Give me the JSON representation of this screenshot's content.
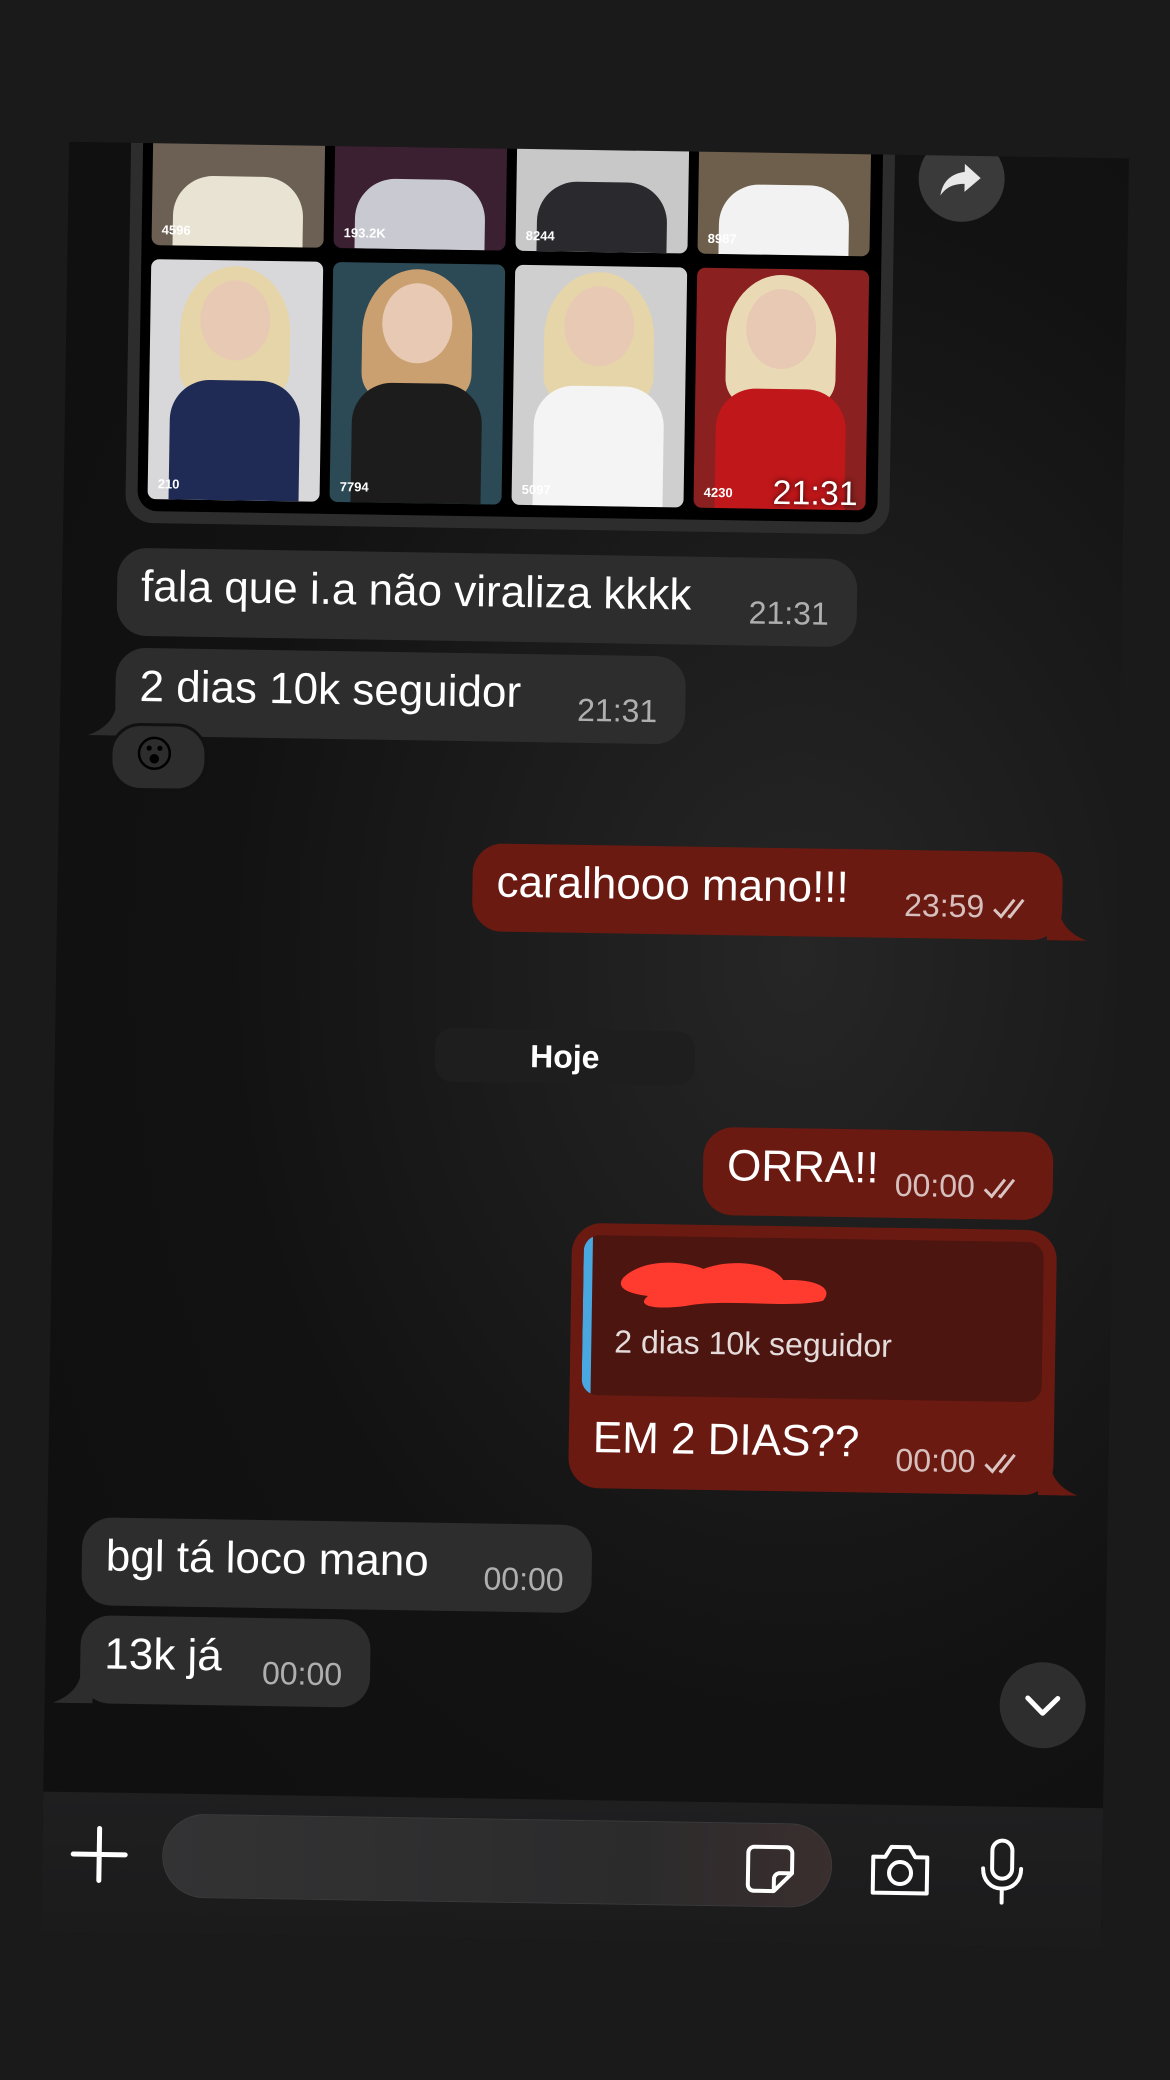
{
  "media_group": {
    "thumbnails": [
      {
        "views": "4596",
        "top": "#e9e3d3"
      },
      {
        "views": "193.2K",
        "top": "#c9c9d2"
      },
      {
        "views": "8244",
        "top": "#2a2a2e"
      },
      {
        "views": "8987",
        "top": "#f2f2f2"
      },
      {
        "views": "210",
        "top": "#1f2a55"
      },
      {
        "views": "7794",
        "top": "#1c1c1c"
      },
      {
        "views": "5097",
        "top": "#f4f4f4"
      },
      {
        "views": "4230",
        "top": "#c0171a"
      }
    ],
    "time": "21:31"
  },
  "messages": [
    {
      "direction": "in",
      "text": "fala que i.a não viraliza kkkk",
      "time": "21:31"
    },
    {
      "direction": "in",
      "text": "2 dias 10k seguidor",
      "time": "21:31"
    },
    {
      "direction": "out",
      "text": "caralhooo mano!!!",
      "time": "23:59"
    },
    {
      "direction": "out",
      "text": "ORRA!!",
      "time": "00:00"
    },
    {
      "direction": "out",
      "text": "EM 2 DIAS??",
      "time": "00:00"
    },
    {
      "direction": "in",
      "text": "bgl tá loco mano",
      "time": "00:00"
    },
    {
      "direction": "in",
      "text": "13k já",
      "time": "00:00"
    }
  ],
  "reaction": {
    "emoji": "😮"
  },
  "day_separator": "Hoje",
  "reply_quote": {
    "text": "2 dias 10k seguidor"
  },
  "composer": {
    "placeholder": ""
  },
  "icons": {
    "forward": "forward-icon",
    "scroll_down": "chevron-down-icon",
    "add": "plus-icon",
    "sticker": "sticker-icon",
    "camera": "camera-icon",
    "microphone": "microphone-icon"
  },
  "colors": {
    "incoming_bubble": "#2d2d2e",
    "outgoing_bubble": "#6b1a12",
    "reply_bar": "#4aa8e0",
    "redaction": "#ff3b30"
  }
}
